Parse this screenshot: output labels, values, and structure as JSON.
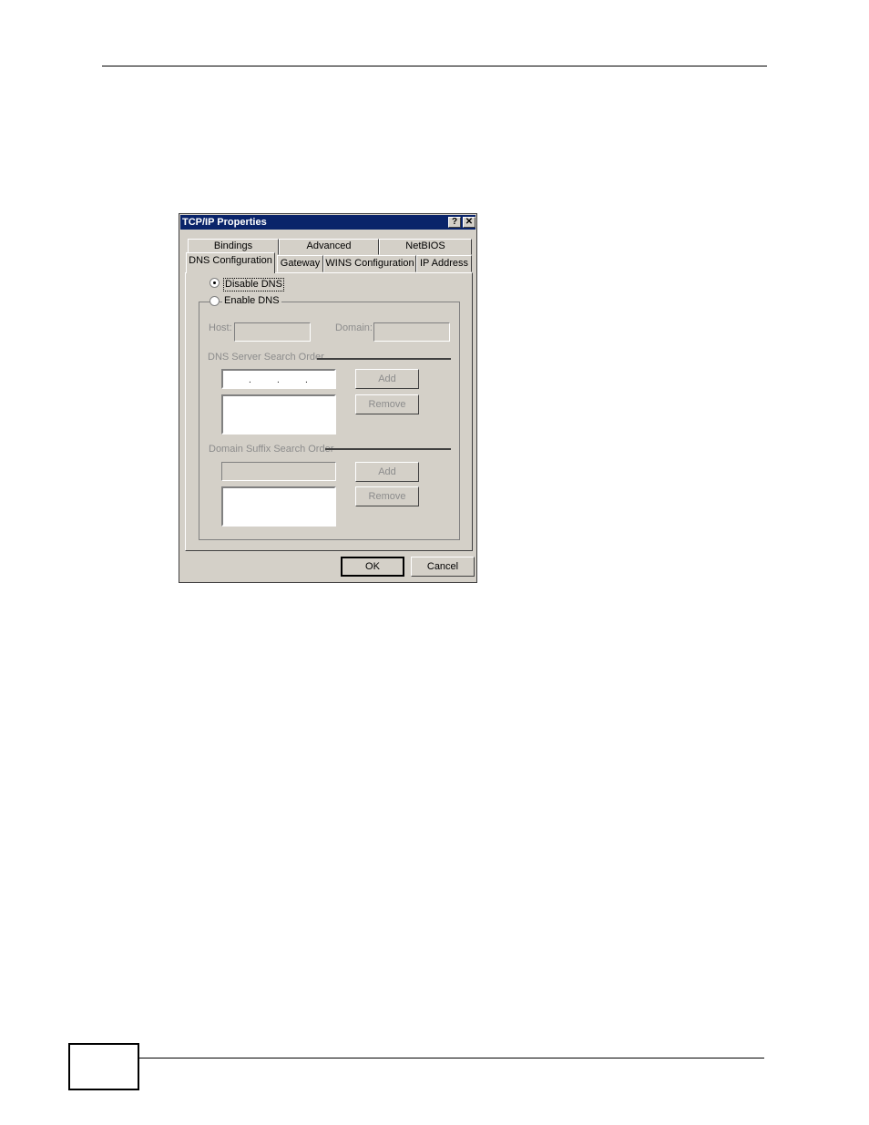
{
  "dialog": {
    "title": "TCP/IP Properties",
    "help_button": "?",
    "close_button": "✕",
    "tabs_back_row": [
      "Bindings",
      "Advanced",
      "NetBIOS"
    ],
    "tabs_front_row": [
      "DNS Configuration",
      "Gateway",
      "WINS Configuration",
      "IP Address"
    ],
    "active_tab": "DNS Configuration"
  },
  "dns": {
    "disable_label": "Disable DNS",
    "enable_label": "Enable DNS",
    "selected": "Disable DNS",
    "host_label": "Host:",
    "host_value": "",
    "domain_label": "Domain:",
    "domain_value": "",
    "server_section_label": "DNS Server Search Order",
    "server_ip_value": "",
    "server_add": "Add",
    "server_remove": "Remove",
    "server_list": [],
    "suffix_section_label": "Domain Suffix Search Order",
    "suffix_value": "",
    "suffix_add": "Add",
    "suffix_remove": "Remove",
    "suffix_list": []
  },
  "footer": {
    "ok": "OK",
    "cancel": "Cancel"
  },
  "icons": {
    "help": "help-icon",
    "close": "close-icon"
  }
}
